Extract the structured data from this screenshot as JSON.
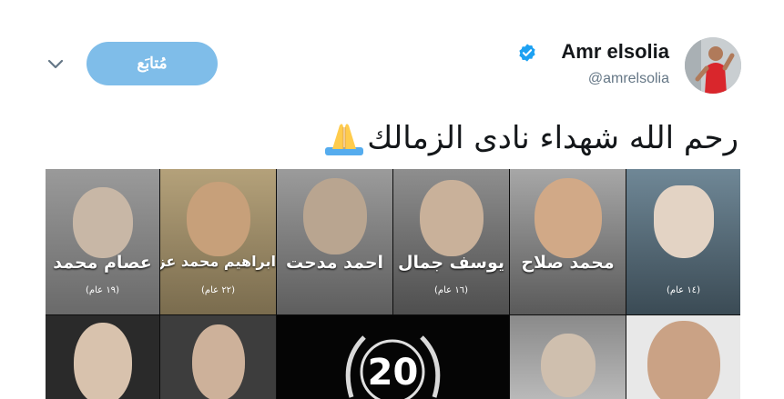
{
  "header": {
    "follow_label": "مُتابَع",
    "display_name": "Amr elsolia",
    "handle": "@amrelsolia"
  },
  "tweet": {
    "text": "رحم الله شهداء نادى الزمالك"
  },
  "media": {
    "tiles": [
      {
        "name": "عصام محمد",
        "age": "(١٩ عام)"
      },
      {
        "name": "ابراهيم محمد عزام",
        "age": "(٢٢ عام)"
      },
      {
        "name": "احمد مدحت",
        "age": ""
      },
      {
        "name": "يوسف جمال",
        "age": "(١٦ عام)"
      },
      {
        "name": "محمد صلاح",
        "age": ""
      },
      {
        "name": "",
        "age": "(١٤ عام)"
      }
    ],
    "emblem_number": "20"
  },
  "colors": {
    "follow_bg": "#7fbde9",
    "verified": "#1da1f2",
    "text_primary": "#14171a",
    "text_secondary": "#657786"
  }
}
